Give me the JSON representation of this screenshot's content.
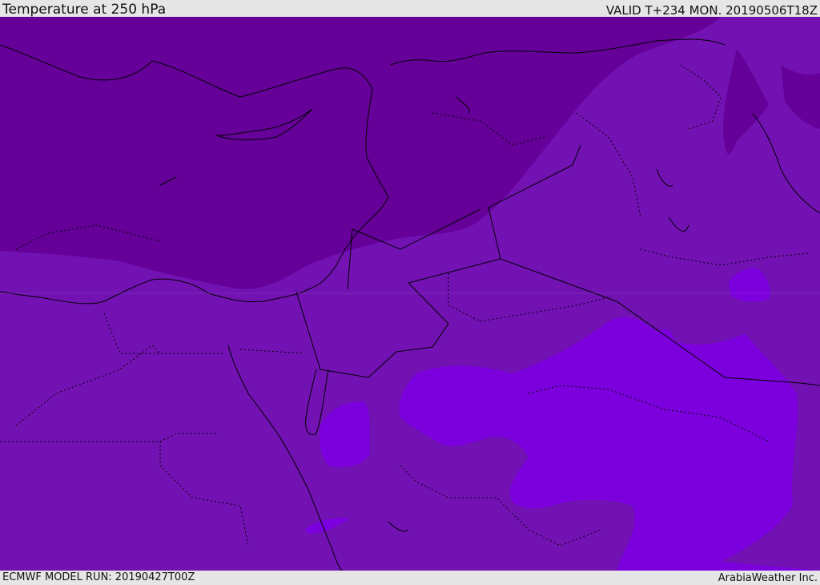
{
  "header": {
    "title": "Temperature at 250 hPa",
    "valid": "VALID T+234 MON. 20190506T18Z"
  },
  "footer": {
    "model_run": "ECMWF MODEL RUN: 20190427T00Z",
    "credit": "ArabiaWeather Inc."
  },
  "colors": {
    "cold_zone": "#650099",
    "mid_zone": "#7212b3",
    "warm_zone": "#7b00dd",
    "coastline": "#000000",
    "background": "#e6e6e6"
  }
}
